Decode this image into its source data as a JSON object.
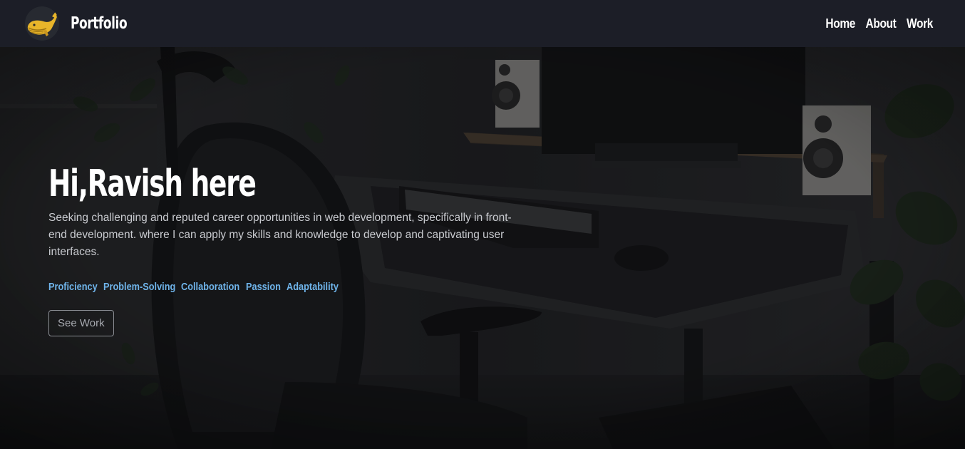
{
  "nav": {
    "brand": "Portfolio",
    "links": [
      "Home",
      "About",
      "Work"
    ]
  },
  "hero": {
    "title": "Hi,Ravish here",
    "description": "Seeking challenging and reputed career opportunities in web development, specifically in front-end development. where I can apply my skills and knowledge to develop and captivating user interfaces.",
    "skills": [
      "Proficiency",
      "Problem-Solving",
      "Collaboration",
      "Passion",
      "Adaptability"
    ],
    "cta_label": "See Work"
  },
  "colors": {
    "navbar_bg": "#1c1e27",
    "skill_accent": "#6fb4ea",
    "logo_whale": "#e8b52a"
  },
  "icons": {
    "logo": "whale-logo-icon"
  }
}
